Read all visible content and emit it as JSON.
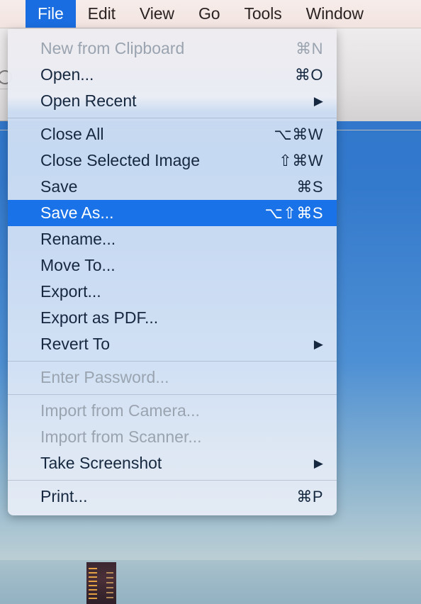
{
  "menubar": {
    "items": [
      {
        "label": "File",
        "active": true
      },
      {
        "label": "Edit",
        "active": false
      },
      {
        "label": "View",
        "active": false
      },
      {
        "label": "Go",
        "active": false
      },
      {
        "label": "Tools",
        "active": false
      },
      {
        "label": "Window",
        "active": false
      }
    ]
  },
  "background": {
    "toolbar_icon": "search-icon",
    "wallpaper_color": "#2f73c9",
    "photo_description": "cityscape"
  },
  "colors": {
    "accent_highlight": "#1a72e8",
    "menubar_highlight": "#1a6de0",
    "menu_text": "#16283f",
    "menu_text_disabled": "#9aa4b0",
    "menu_background": "#c9dcf2"
  },
  "file_menu": {
    "title": "File",
    "groups": [
      {
        "items": [
          {
            "label": "New from Clipboard",
            "shortcut": "⌘N",
            "disabled": true,
            "selected": false,
            "submenu": false
          },
          {
            "label": "Open...",
            "shortcut": "⌘O",
            "disabled": false,
            "selected": false,
            "submenu": false
          },
          {
            "label": "Open Recent",
            "shortcut": "",
            "disabled": false,
            "selected": false,
            "submenu": true
          }
        ]
      },
      {
        "items": [
          {
            "label": "Close All",
            "shortcut": "⌥⌘W",
            "disabled": false,
            "selected": false,
            "submenu": false
          },
          {
            "label": "Close Selected Image",
            "shortcut": "⇧⌘W",
            "disabled": false,
            "selected": false,
            "submenu": false
          },
          {
            "label": "Save",
            "shortcut": "⌘S",
            "disabled": false,
            "selected": false,
            "submenu": false
          },
          {
            "label": "Save As...",
            "shortcut": "⌥⇧⌘S",
            "disabled": false,
            "selected": true,
            "submenu": false
          },
          {
            "label": "Rename...",
            "shortcut": "",
            "disabled": false,
            "selected": false,
            "submenu": false
          },
          {
            "label": "Move To...",
            "shortcut": "",
            "disabled": false,
            "selected": false,
            "submenu": false
          },
          {
            "label": "Export...",
            "shortcut": "",
            "disabled": false,
            "selected": false,
            "submenu": false
          },
          {
            "label": "Export as PDF...",
            "shortcut": "",
            "disabled": false,
            "selected": false,
            "submenu": false
          },
          {
            "label": "Revert To",
            "shortcut": "",
            "disabled": false,
            "selected": false,
            "submenu": true
          }
        ]
      },
      {
        "items": [
          {
            "label": "Enter Password...",
            "shortcut": "",
            "disabled": true,
            "selected": false,
            "submenu": false
          }
        ]
      },
      {
        "items": [
          {
            "label": "Import from Camera...",
            "shortcut": "",
            "disabled": true,
            "selected": false,
            "submenu": false
          },
          {
            "label": "Import from Scanner...",
            "shortcut": "",
            "disabled": true,
            "selected": false,
            "submenu": false
          },
          {
            "label": "Take Screenshot",
            "shortcut": "",
            "disabled": false,
            "selected": false,
            "submenu": true
          }
        ]
      },
      {
        "items": [
          {
            "label": "Print...",
            "shortcut": "⌘P",
            "disabled": false,
            "selected": false,
            "submenu": false
          }
        ]
      }
    ]
  }
}
